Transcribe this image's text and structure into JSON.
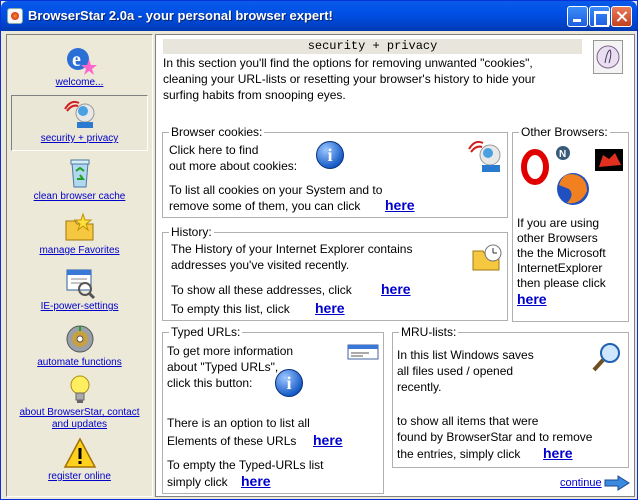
{
  "window": {
    "title": "BrowserStar 2.0a  - your personal browser expert!"
  },
  "sidebar": {
    "items": [
      {
        "label": "welcome..."
      },
      {
        "label": "security + privacy"
      },
      {
        "label": "clean browser cache"
      },
      {
        "label": "manage Favorites"
      },
      {
        "label": "IE-power-settings"
      },
      {
        "label": "automate functions"
      },
      {
        "label": "about BrowserStar, contact and updates"
      },
      {
        "label": "register online"
      }
    ]
  },
  "main": {
    "section_title": "security + privacy",
    "description": "In this section you'll find the options for removing unwanted \"cookies\", cleaning your URL-lists or resetting your browser's history to hide your surfing habits from snooping eyes.",
    "cookies": {
      "title": "Browser cookies:",
      "text1a": "Click here to find",
      "text1b": "out more about cookies:",
      "text2a": "To list all cookies on your System and to",
      "text2b": "remove some of them, you can click",
      "link": "here"
    },
    "history": {
      "title": "History:",
      "text1a": "The History of your Internet Explorer contains",
      "text1b": "addresses you've visited recently.",
      "text2": "To show all these addresses, click",
      "link1": "here",
      "text3": "To empty this list, click",
      "link2": "here"
    },
    "other_browsers": {
      "title": "Other Browsers:",
      "text1": "If you are using",
      "text2": "other Browsers",
      "text3": "the the Microsoft",
      "text4": "InternetExplorer",
      "text5": "then please click",
      "link": "here"
    },
    "typed_urls": {
      "title": "Typed URLs:",
      "text1a": "To get more information",
      "text1b": "about \"Typed URLs\",",
      "text1c": "click this button:",
      "text2a": "There is an option to list all",
      "text2b": "Elements of these URLs",
      "link1": "here",
      "text3a": "To empty the Typed-URLs list",
      "text3b": "simply click",
      "link2": "here"
    },
    "mru": {
      "title": "MRU-lists:",
      "text1a": "In this list Windows saves",
      "text1b": "all files used / opened",
      "text1c": "recently.",
      "text2a": "to show all items that were",
      "text2b": "found by BrowserStar and to remove",
      "text2c": "the entries, simply click",
      "link": "here"
    },
    "continue_label": "continue",
    "info_glyph": "i"
  },
  "colors": {
    "title_bar": "#0050E6",
    "link": "#0000CC",
    "title_strip": "#E8E6DC"
  }
}
